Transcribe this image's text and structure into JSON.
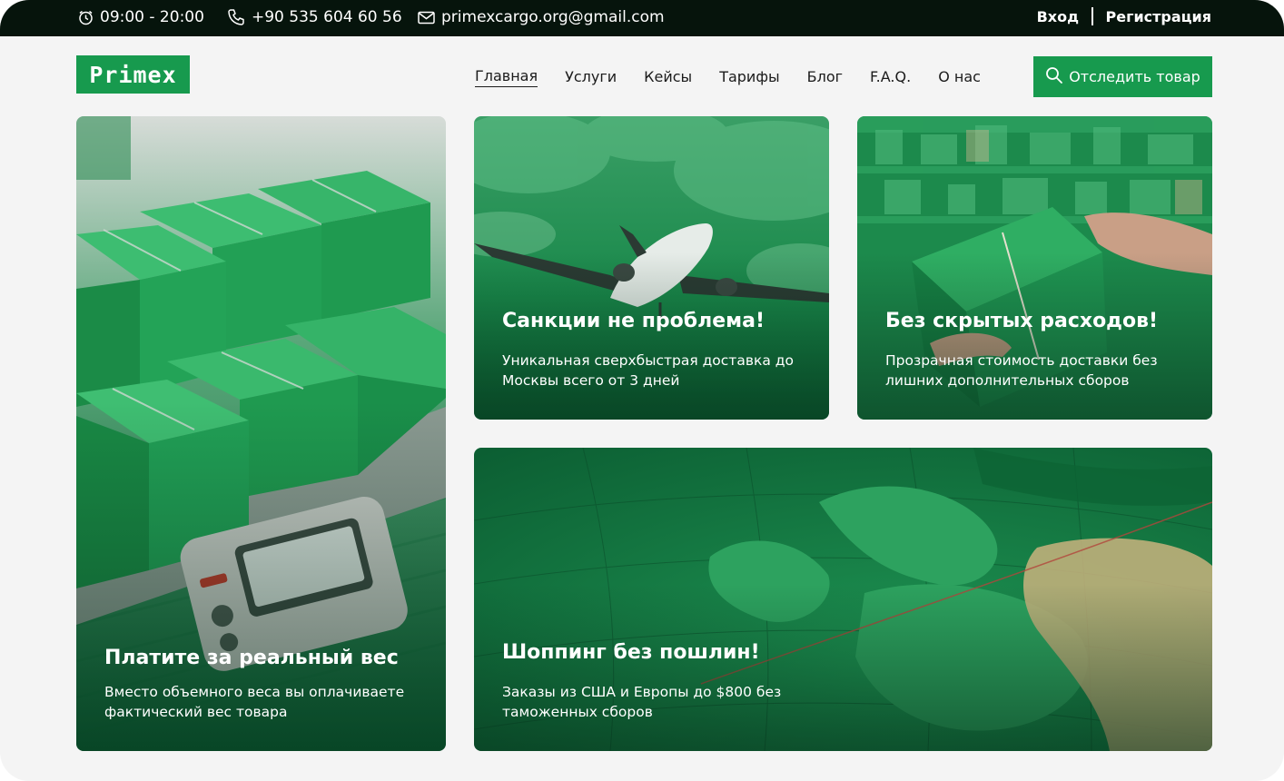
{
  "topbar": {
    "hours": "09:00 - 20:00",
    "phone": "+90 535 604 60 56",
    "email": "primexcargo.org@gmail.com",
    "login": "Вход",
    "register": "Регистрация",
    "icons": [
      "clock-icon",
      "phone-icon",
      "mail-icon"
    ]
  },
  "header": {
    "logo": "Primex",
    "nav": [
      "Главная",
      "Услуги",
      "Кейсы",
      "Тарифы",
      "Блог",
      "F.A.Q.",
      "О нас"
    ],
    "active_nav": "Главная",
    "track_button": "Отследить товар"
  },
  "cards": {
    "weight": {
      "title": "Платите за реальный вес",
      "desc": "Вместо объемного веса вы оплачиваете фактический вес товара"
    },
    "sanctions": {
      "title": "Санкции не проблема!",
      "desc": "Уникальная сверхбыстрая доставка до Москвы всего от 3 дней"
    },
    "costs": {
      "title": "Без скрытых расходов!",
      "desc": "Прозрачная стоимость доставки без лишних дополнительных сборов"
    },
    "shopping": {
      "title": "Шоппинг без пошлин!",
      "desc": "Заказы из США и Европы до $800 без таможенных сборов"
    }
  },
  "colors": {
    "brand_green": "#179a4e",
    "topbar_bg": "#06140c",
    "page_bg": "#f4f4f4"
  }
}
